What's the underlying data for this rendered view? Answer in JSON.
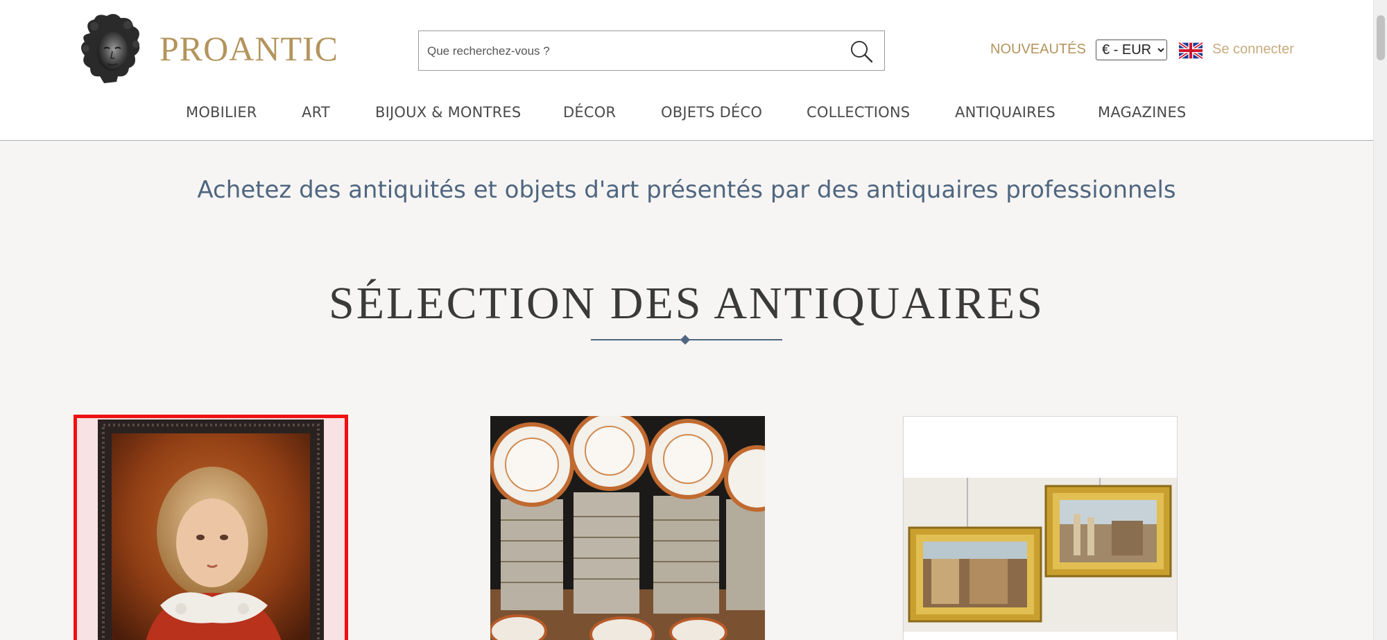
{
  "brand": {
    "name": "PROANTIC"
  },
  "search": {
    "placeholder": "Que recherchez-vous ?"
  },
  "header": {
    "nouveautes_label": "NOUVEAUTÉS",
    "currency_selected": "€ - EUR",
    "language_icon": "uk-flag-icon",
    "signin_label": "Se connecter"
  },
  "nav": {
    "items": [
      {
        "label": "MOBILIER"
      },
      {
        "label": "ART"
      },
      {
        "label": "BIJOUX & MONTRES"
      },
      {
        "label": "DÉCOR"
      },
      {
        "label": "OBJETS DÉCO"
      },
      {
        "label": "COLLECTIONS"
      },
      {
        "label": "ANTIQUAIRES"
      },
      {
        "label": "MAGAZINES"
      }
    ]
  },
  "main": {
    "tagline": "Achetez des antiquités et objets d'art présentés par des antiquaires professionnels",
    "section_title": "SÉLECTION DES ANTIQUAIRES"
  },
  "products": [
    {
      "image": "portrait-of-child-painting",
      "selected": true
    },
    {
      "image": "porcelain-dinner-service"
    },
    {
      "image": "pair-of-gilt-framed-paintings"
    }
  ],
  "colors": {
    "brand_gold": "#b3945c",
    "nav_text": "#4a4a4a",
    "tagline_blue": "#4f6680",
    "selection_red": "#ee1111",
    "page_bg": "#f6f5f3"
  }
}
